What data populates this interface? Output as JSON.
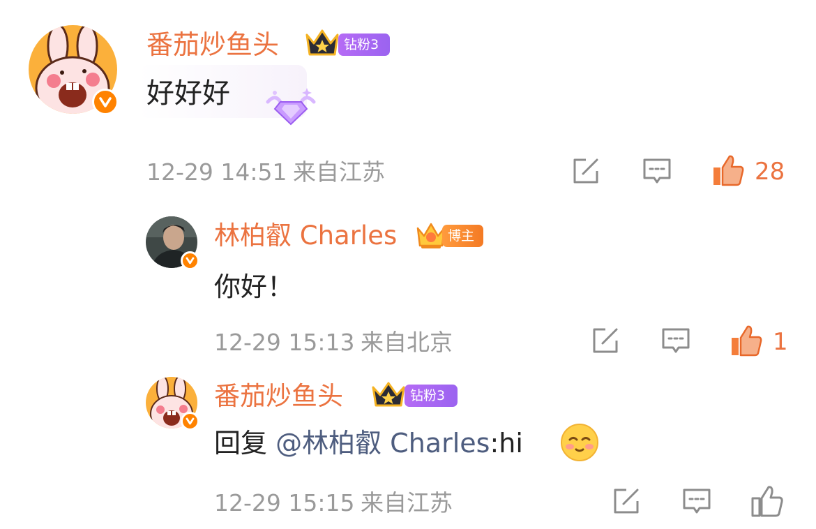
{
  "comments": [
    {
      "username": "番茄炒鱼头",
      "badge": "钻粉3",
      "text": "好好好",
      "time": "12-29 14:51",
      "location": "来自江苏",
      "like_count": "28"
    },
    {
      "username": "林柏叡 Charles",
      "badge": "博主",
      "text": "你好！",
      "time": "12-29 15:13",
      "location": "来自北京",
      "like_count": "1"
    },
    {
      "username": "番茄炒鱼头",
      "badge": "钻粉3",
      "reply_prefix": "回复 ",
      "mention": "@林柏叡 Charles",
      "reply_text": ":hi",
      "time": "12-29 15:15",
      "location": "来自江苏",
      "emoji": "blush-emoji"
    }
  ],
  "icons": {
    "share": "share-icon",
    "comment": "comment-icon",
    "like": "like-icon",
    "verified": "verified-icon",
    "crown": "crown-icon"
  },
  "colors": {
    "username": "#eb7340",
    "meta": "#9a9a9a",
    "mention": "#4e5d7f",
    "liked": "#eb7340",
    "icon": "#8c8c8c",
    "verified": "#ff8200",
    "fan_badge": "#a866f3",
    "author_badge": "#f78a30"
  }
}
